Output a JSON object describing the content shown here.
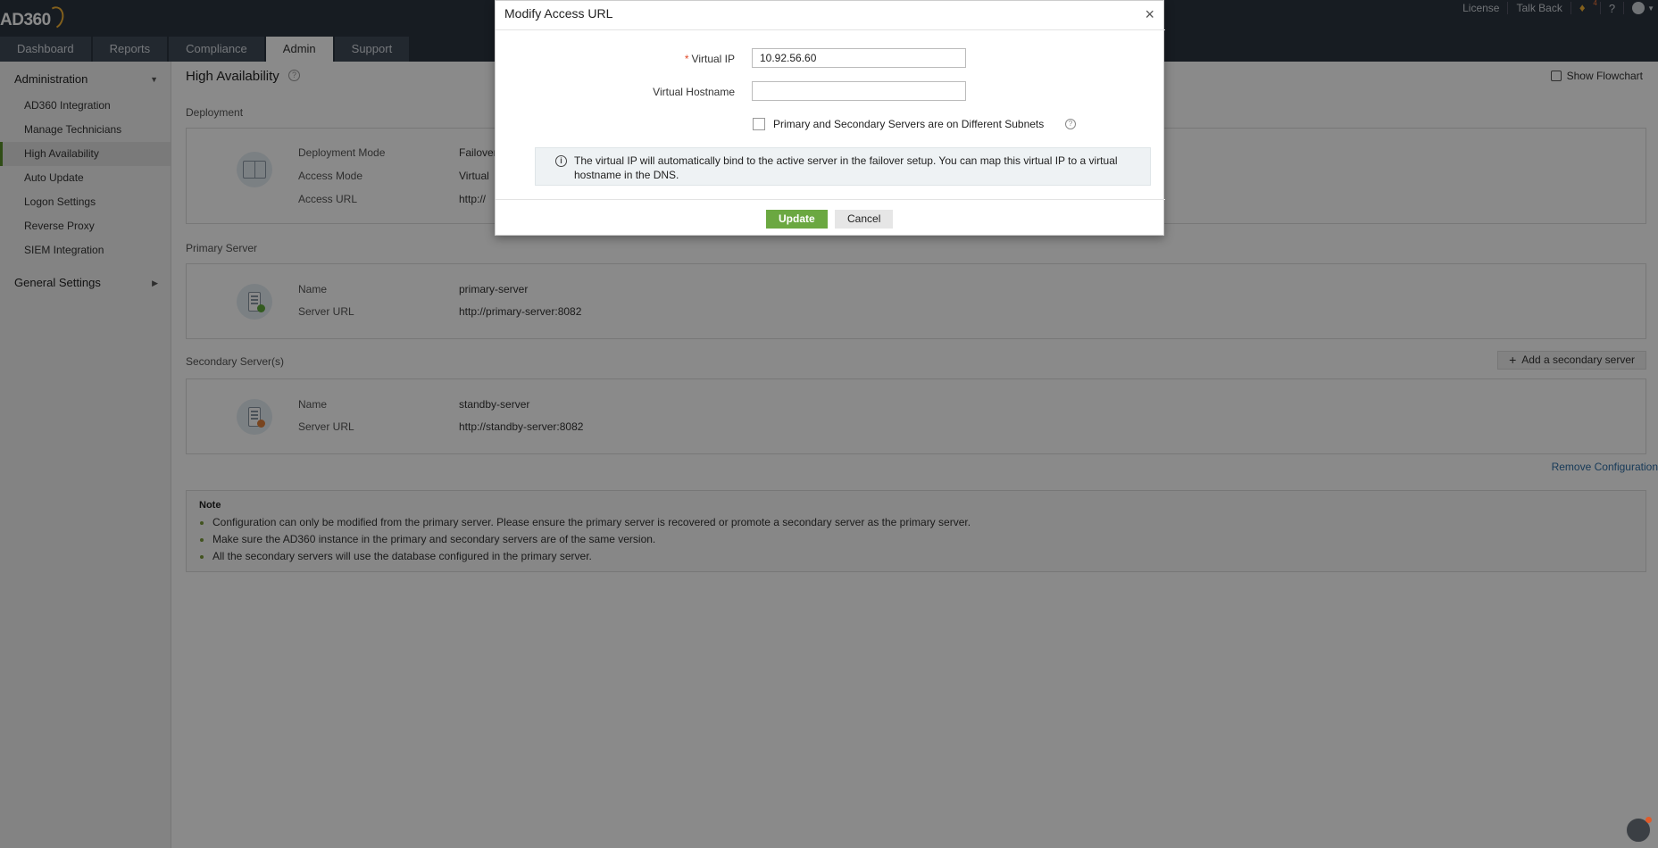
{
  "header": {
    "logo": "AD360",
    "tabs": [
      "Dashboard",
      "Reports",
      "Compliance",
      "Admin",
      "Support"
    ],
    "active_tab": "Admin",
    "top_links": {
      "license": "License",
      "talk_back": "Talk Back",
      "help": "?"
    },
    "notification_count": "4"
  },
  "sidebar": {
    "section_title": "Administration",
    "items": [
      "AD360 Integration",
      "Manage Technicians",
      "High Availability",
      "Auto Update",
      "Logon Settings",
      "Reverse Proxy",
      "SIEM Integration"
    ],
    "active_item": "High Availability",
    "section2_title": "General Settings"
  },
  "main": {
    "title": "High Availability",
    "flowchart_label": "Show Flowchart",
    "deployment": {
      "label": "Deployment",
      "mode_label": "Deployment Mode",
      "mode_value": "Failover",
      "access_mode_label": "Access Mode",
      "access_mode_value": "Virtual",
      "access_url_label": "Access URL",
      "access_url_value": "http://"
    },
    "primary": {
      "label": "Primary Server",
      "name_label": "Name",
      "name_value": "primary-server",
      "url_label": "Server URL",
      "url_value": "http://primary-server:8082"
    },
    "secondary": {
      "label": "Secondary Server(s)",
      "add_label": "Add a secondary server",
      "name_label": "Name",
      "name_value": "standby-server",
      "url_label": "Server URL",
      "url_value": "http://standby-server:8082"
    },
    "remove_configuration": "Remove Configuration",
    "note": {
      "title": "Note",
      "items": [
        "Configuration can only be modified from the primary server. Please ensure the primary server is recovered or promote a secondary server as the primary server.",
        "Make sure the AD360 instance in the primary and secondary servers are of the same version.",
        "All the secondary servers will use the database configured in the primary server."
      ]
    }
  },
  "modal": {
    "title": "Modify Access URL",
    "virtual_ip_label": "Virtual IP",
    "virtual_ip_value": "10.92.56.60",
    "virtual_hostname_label": "Virtual Hostname",
    "virtual_hostname_value": "",
    "subnet_checkbox_label": "Primary and Secondary Servers are on Different Subnets",
    "info_text": "The virtual IP will automatically bind to the active server in the failover setup. You can map this virtual IP to a virtual hostname in the DNS.",
    "update_label": "Update",
    "cancel_label": "Cancel"
  },
  "colors": {
    "topbar": "#2b3440",
    "accent_green": "#6ba841",
    "link_blue": "#2e6da4",
    "required_red": "#e14b2b"
  }
}
